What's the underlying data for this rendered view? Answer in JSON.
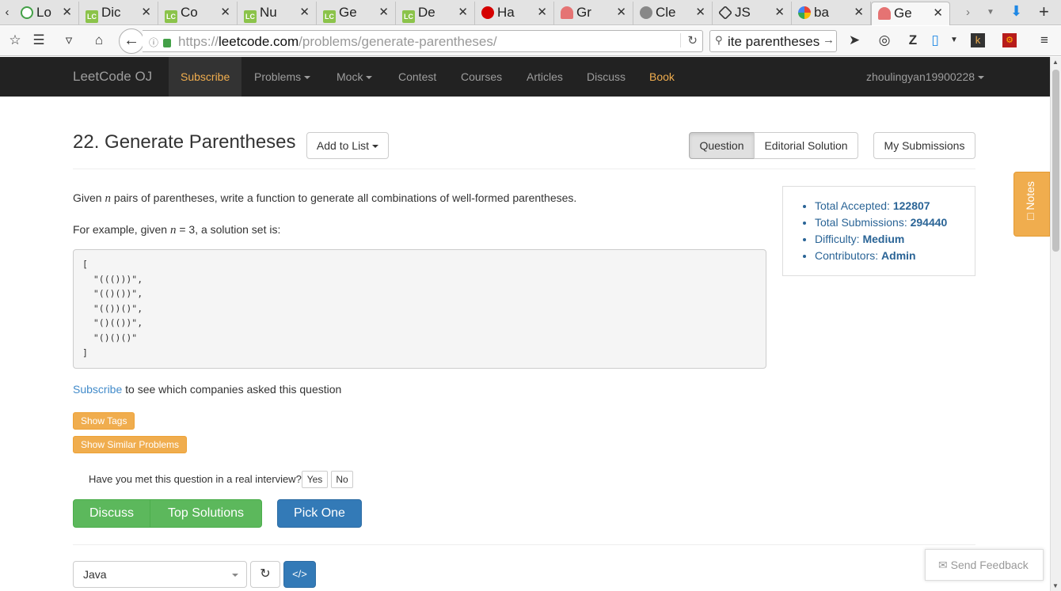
{
  "browser": {
    "tabs": [
      {
        "title": "Lo",
        "favicon": "lo"
      },
      {
        "title": "Dic",
        "favicon": "lc"
      },
      {
        "title": "Co",
        "favicon": "lc"
      },
      {
        "title": "Nu",
        "favicon": "lc"
      },
      {
        "title": "Ge",
        "favicon": "lc"
      },
      {
        "title": "De",
        "favicon": "lc"
      },
      {
        "title": "Ha",
        "favicon": "red"
      },
      {
        "title": "Gr",
        "favicon": "mis"
      },
      {
        "title": "Cle",
        "favicon": "grey"
      },
      {
        "title": "JS",
        "favicon": "hexi"
      },
      {
        "title": "ba",
        "favicon": "g"
      },
      {
        "title": "Ge",
        "favicon": "mis"
      }
    ],
    "url_scheme": "https://",
    "url_host": "leetcode.com",
    "url_path": "/problems/generate-parentheses/",
    "search_text": "ite parentheses"
  },
  "site": {
    "brand": "LeetCode OJ",
    "nav": {
      "subscribe": "Subscribe",
      "problems": "Problems",
      "mock": "Mock",
      "contest": "Contest",
      "courses": "Courses",
      "articles": "Articles",
      "discuss": "Discuss",
      "book": "Book",
      "user": "zhoulingyan19900228"
    },
    "accent": "#f0ad4e"
  },
  "problem": {
    "title": "22. Generate Parentheses",
    "add_to_list": "Add to List",
    "tabs": {
      "question": "Question",
      "editorial": "Editorial Solution"
    },
    "my_submissions": "My Submissions",
    "desc1_pre": "Given ",
    "desc1_var": "n",
    "desc1_post": " pairs of parentheses, write a function to generate all combinations of well-formed parentheses.",
    "desc2_pre": "For example, given ",
    "desc2_var": "n",
    "desc2_post": " = 3, a solution set is:",
    "example": "[\n  \"((()))\",\n  \"(()())\",\n  \"(())()\",\n  \"()(())\",\n  \"()()()\"\n]",
    "subscribe_link": "Subscribe",
    "subscribe_rest": " to see which companies asked this question",
    "show_tags": "Show Tags",
    "show_similar": "Show Similar Problems",
    "interview_q": "Have you met this question in a real interview?",
    "yes": "Yes",
    "no": "No",
    "discuss_btn": "Discuss",
    "top_solutions_btn": "Top Solutions",
    "pick_one_btn": "Pick One"
  },
  "stats": {
    "accepted_label": "Total Accepted: ",
    "accepted_value": "122807",
    "submissions_label": "Total Submissions: ",
    "submissions_value": "294440",
    "difficulty_label": "Difficulty: ",
    "difficulty_value": "Medium",
    "contributors_label": "Contributors: ",
    "contributors_value": "Admin"
  },
  "notes_label": "Notes",
  "editor": {
    "language": "Java"
  },
  "feedback": "Send Feedback"
}
